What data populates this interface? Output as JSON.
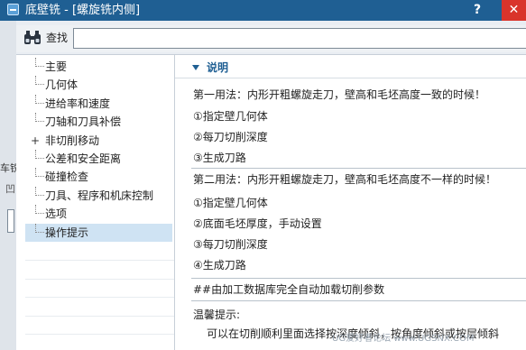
{
  "window": {
    "title": "底壁铣 - [螺旋铣内侧]",
    "help_glyph": "?",
    "close_glyph": "✕"
  },
  "background_fragments": {
    "frag1": "车铣",
    "frag2": "凹"
  },
  "search": {
    "label": "查找",
    "value": "",
    "placeholder": ""
  },
  "tree": {
    "items": [
      {
        "label": "主要",
        "expandable": false,
        "selected": false
      },
      {
        "label": "几何体",
        "expandable": false,
        "selected": false
      },
      {
        "label": "进给率和速度",
        "expandable": false,
        "selected": false
      },
      {
        "label": "刀轴和刀具补偿",
        "expandable": false,
        "selected": false
      },
      {
        "label": "非切削移动",
        "expandable": true,
        "selected": false
      },
      {
        "label": "公差和安全距离",
        "expandable": false,
        "selected": false
      },
      {
        "label": "碰撞检查",
        "expandable": false,
        "selected": false
      },
      {
        "label": "刀具、程序和机床控制",
        "expandable": false,
        "selected": false
      },
      {
        "label": "选项",
        "expandable": false,
        "selected": false
      },
      {
        "label": "操作提示",
        "expandable": false,
        "selected": true
      }
    ],
    "expand_glyph": "+"
  },
  "section": {
    "title": "说明",
    "lines": [
      "第一用法：内形开粗螺旋走刀，壁高和毛坯高度一致的时候！",
      "①指定壁几何体",
      "②每刀切削深度",
      "③生成刀路",
      "第二用法：内形开粗螺旋走刀，壁高和毛坯高度不一样的时候！",
      "①指定壁几何体",
      "②底面毛坯厚度，手动设置",
      "③每刀切削深度",
      "④生成刀路",
      "##由加工数据库完全自动加载切削参数",
      "温馨提示:",
      "可以在切削顺利里面选择按深度倾斜，按角度倾斜或按层倾斜"
    ]
  },
  "watermark": "UG爱好者论坛 www.UGSNX.COM",
  "colors": {
    "titlebar": "#1f5f93",
    "close_button": "#d9342b",
    "selected_row": "#cfe3f3",
    "section_title": "#1f5f93"
  },
  "icons": {
    "app": "app-icon",
    "search": "binoculars-icon",
    "section_toggle": "triangle-down-icon"
  }
}
